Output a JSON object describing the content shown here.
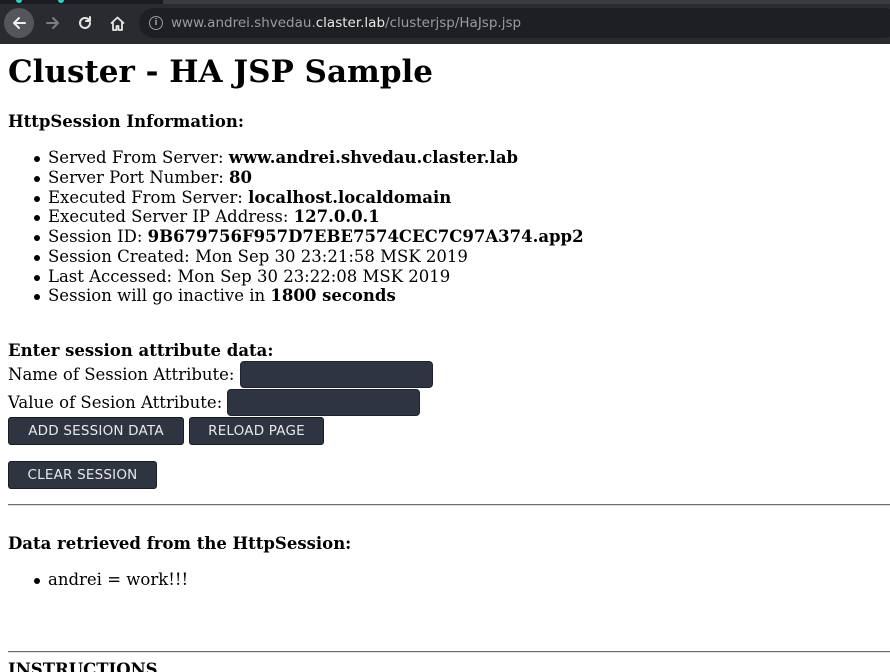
{
  "browser": {
    "url_prefix": "www.andrei.shvedau.",
    "url_host": "claster.lab",
    "url_path": "/clusterjsp/HaJsp.jsp"
  },
  "page": {
    "title": "Cluster - HA JSP Sample",
    "session_info_heading": "HttpSession Information:",
    "session_info": [
      {
        "label": "Served From Server: ",
        "value": "www.andrei.shvedau.claster.lab"
      },
      {
        "label": "Server Port Number: ",
        "value": "80"
      },
      {
        "label": "Executed From Server: ",
        "value": "localhost.localdomain"
      },
      {
        "label": "Executed Server IP Address: ",
        "value": "127.0.0.1"
      },
      {
        "label": "Session ID: ",
        "value": "9B679756F957D7EBE7574CEC7C97A374.app2"
      },
      {
        "label": "Session Created: ",
        "value": "Mon Sep 30 23:21:58 MSK 2019"
      },
      {
        "label": "Last Accessed: ",
        "value": "Mon Sep 30 23:22:08 MSK 2019"
      },
      {
        "label": "Session will go inactive in ",
        "value": "1800 seconds"
      }
    ],
    "form_heading": "Enter session attribute data:",
    "name_label": "Name of Session Attribute:",
    "name_value": "",
    "value_label": "Value of Sesion Attribute:",
    "value_value": "",
    "add_button": "ADD SESSION DATA",
    "reload_button": "RELOAD PAGE",
    "clear_button": "CLEAR SESSION",
    "data_heading": "Data retrieved from the HttpSession:",
    "data_items": [
      "andrei = work!!!"
    ],
    "instructions_heading": "INSTRUCTIONS"
  },
  "colors": {
    "button_bg": "#2f3441",
    "button_text": "#e6e8ee",
    "chrome_bg": "#2a2b30",
    "tab_accent": "#2ad3c8"
  }
}
